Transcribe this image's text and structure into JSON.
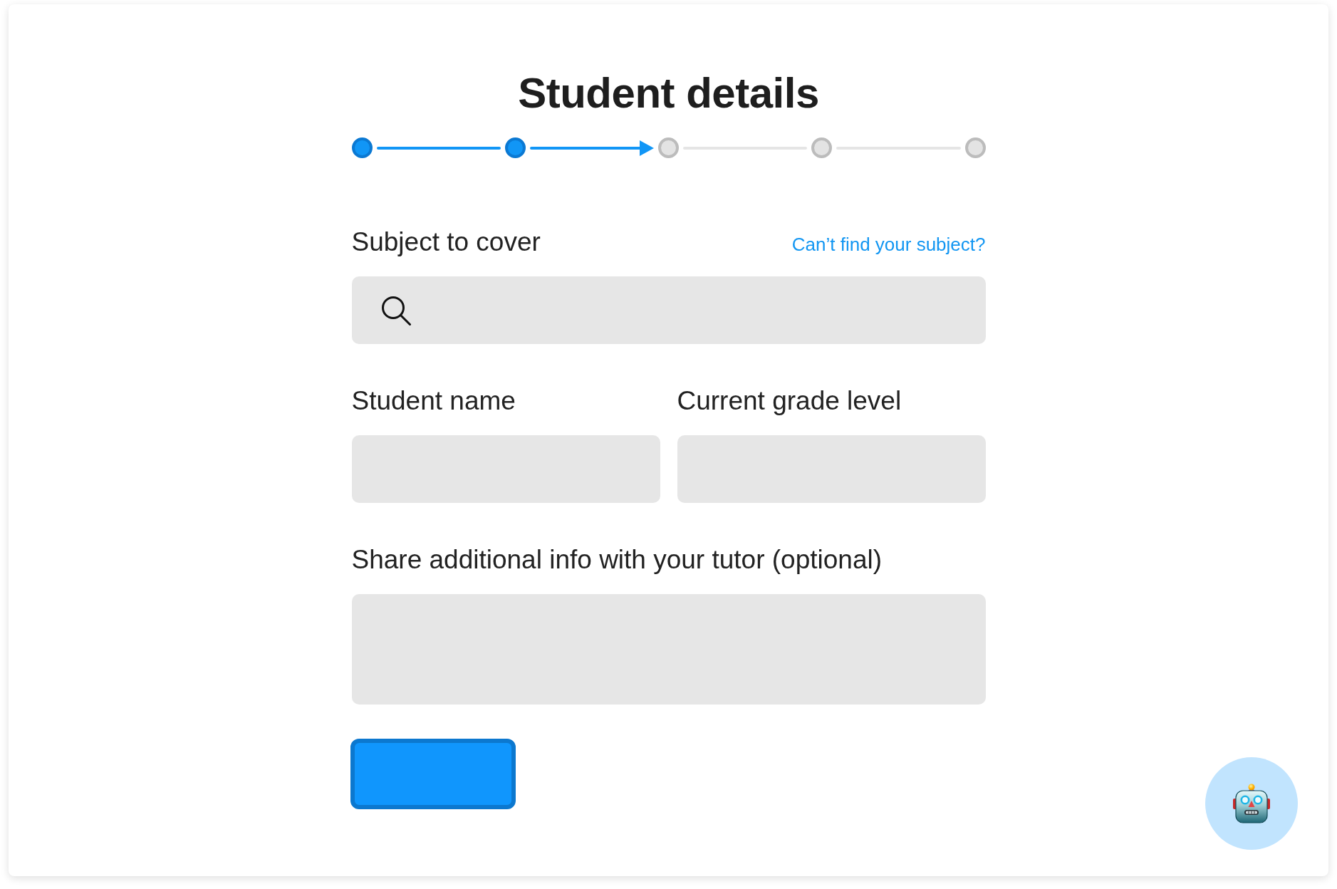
{
  "title": "Student details",
  "steps": [
    {
      "done": true
    },
    {
      "done": true
    },
    {
      "done": false
    },
    {
      "done": false
    },
    {
      "done": false
    }
  ],
  "rows": [
    {
      "fields": [
        {
          "kind": "search",
          "label": "Subject to cover",
          "link": "Can’t find your subject?"
        }
      ]
    },
    {
      "fields": [
        {
          "kind": "text",
          "label": "Student name"
        },
        {
          "kind": "text",
          "label": "Current grade level"
        }
      ]
    },
    {
      "fields": [
        {
          "kind": "textarea",
          "label": "Share additional info with your tutor (optional)"
        }
      ]
    }
  ]
}
